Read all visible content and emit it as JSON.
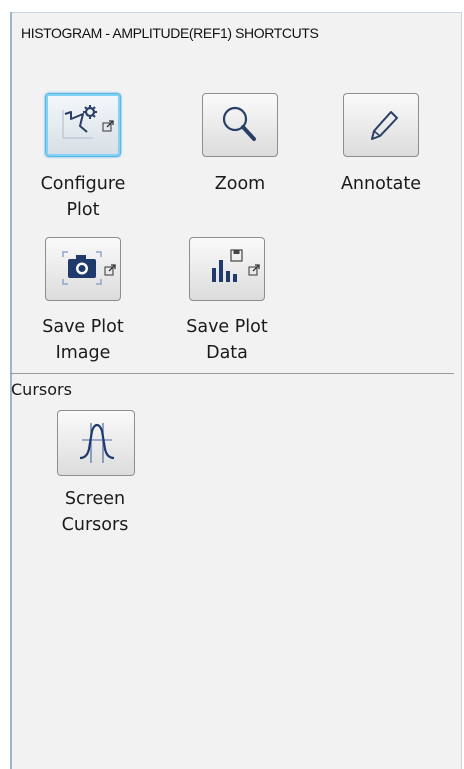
{
  "panel": {
    "title": "HISTOGRAM - AMPLITUDE(REF1) SHORTCUTS"
  },
  "shortcuts": [
    {
      "id": "configure",
      "label_line1": "Configure",
      "label_line2": "Plot",
      "icon": "configure-plot-icon",
      "opens_dialog": true,
      "active": true
    },
    {
      "id": "zoom",
      "label_line1": "Zoom",
      "label_line2": "",
      "icon": "zoom-icon",
      "opens_dialog": false
    },
    {
      "id": "annotate",
      "label_line1": "Annotate",
      "label_line2": "",
      "icon": "pencil-icon",
      "opens_dialog": false
    },
    {
      "id": "save-image",
      "label_line1": "Save Plot",
      "label_line2": "Image",
      "icon": "camera-icon",
      "opens_dialog": true
    },
    {
      "id": "save-data",
      "label_line1": "Save Plot",
      "label_line2": "Data",
      "icon": "bar-chart-save-icon",
      "opens_dialog": true
    }
  ],
  "cursors_section": {
    "heading": "Cursors",
    "items": [
      {
        "id": "screen-cursors",
        "label_line1": "Screen",
        "label_line2": "Cursors",
        "icon": "screen-cursors-icon"
      }
    ]
  },
  "colors": {
    "panel_bg": "#f2f2f2",
    "active_border": "#5bb8e6",
    "icon_blue": "#1f3a6b"
  }
}
